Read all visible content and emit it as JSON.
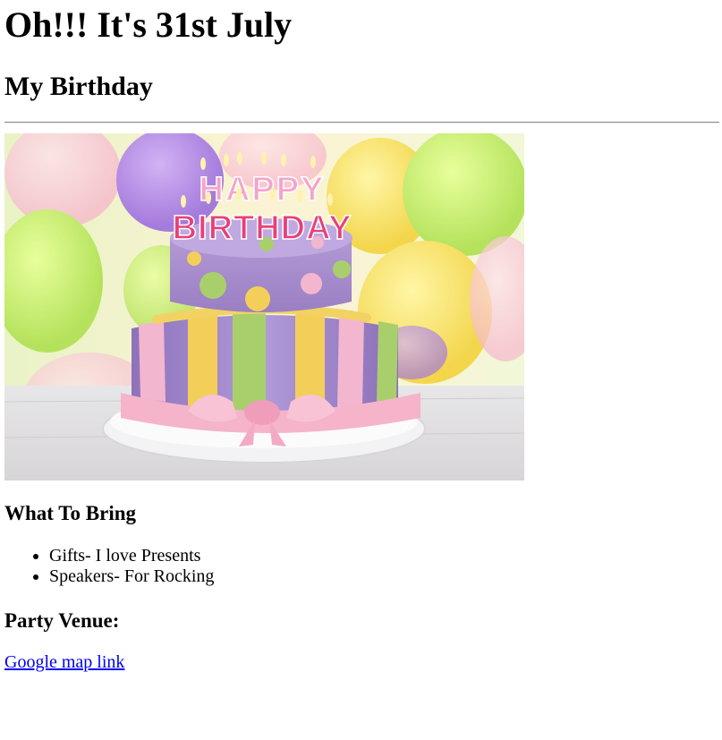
{
  "header": {
    "title": "Oh!!! It's 31st July",
    "subtitle": "My Birthday"
  },
  "image": {
    "subject": "birthday-cake",
    "candle_letters_top": "HAPPY",
    "candle_letters_bottom": "BIRTHDAY",
    "colors": {
      "cake_purple": "#a88ccb",
      "stripe_yellow": "#f3cf5a",
      "stripe_green": "#a9cf6c",
      "stripe_pink": "#f2b6cf",
      "bow_pink": "#f5b4c9",
      "balloon_green": "#c9f07a",
      "balloon_purple": "#b58ae6"
    }
  },
  "bring": {
    "heading": "What To Bring",
    "items": [
      "Gifts- I love Presents",
      "Speakers- For Rocking"
    ]
  },
  "venue": {
    "heading": "Party Venue:",
    "link_text": "Google map link"
  },
  "colors": {
    "link": "#0000ee",
    "text": "#000000",
    "rule": "#8a8a8a"
  }
}
